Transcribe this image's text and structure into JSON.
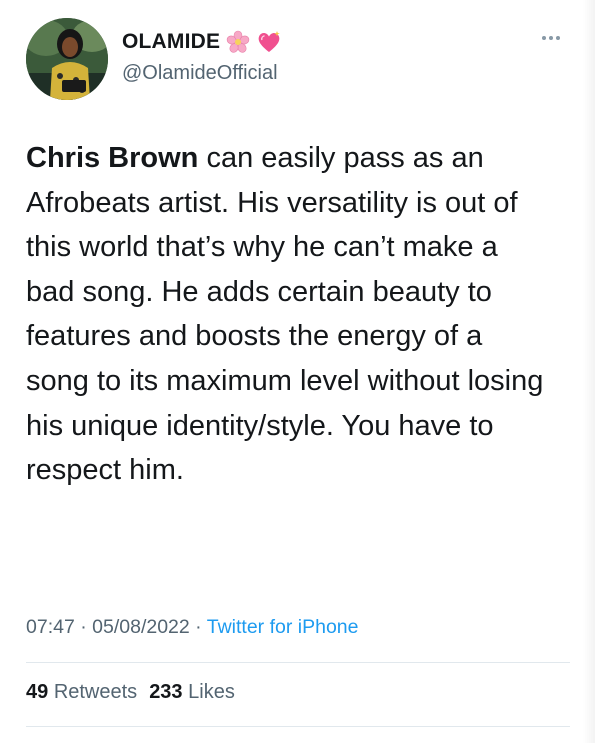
{
  "author": {
    "display_name": "OLAMIDE",
    "handle": "@OlamideOfficial",
    "badges": [
      "cherry-blossom-icon",
      "sparkling-heart-icon"
    ]
  },
  "tweet": {
    "lead": "Chris Brown",
    "body": " can easily pass as an Afrobeats artist. His versatility is out of this world that’s why he can’t make a bad song. He adds certain beauty to features and boosts the energy of a song to its maximum level without losing his unique identity/style. You have to respect him."
  },
  "meta": {
    "time": "07:47",
    "sep1": " · ",
    "date": "05/08/2022",
    "sep2": " · ",
    "source": "Twitter for iPhone"
  },
  "stats": {
    "retweets_count": "49",
    "retweets_label": "Retweets",
    "likes_count": "233",
    "likes_label": "Likes"
  },
  "colors": {
    "text": "#14171a",
    "secondary": "#536471",
    "link": "#1d9bf0",
    "divider": "#e1e8ed"
  }
}
